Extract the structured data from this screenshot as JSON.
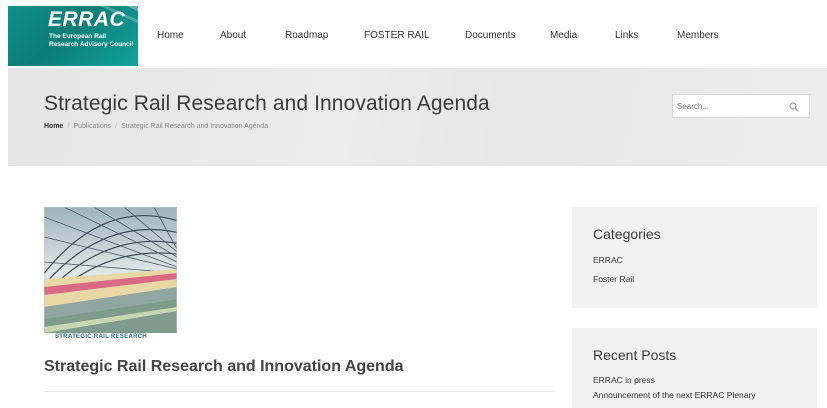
{
  "logo": {
    "brand": "ERRAC",
    "tagline": "The European Rail Research Advisory Council",
    "color": "#0f8f88"
  },
  "nav": {
    "items": [
      {
        "label": "Home"
      },
      {
        "label": "About"
      },
      {
        "label": "Roadmap"
      },
      {
        "label": "FOSTER RAIL"
      },
      {
        "label": "Documents"
      },
      {
        "label": "Media"
      },
      {
        "label": "Links"
      },
      {
        "label": "Members"
      }
    ]
  },
  "title_band": {
    "title": "Strategic Rail Research and Innovation Agenda",
    "breadcrumb": [
      "Home",
      "Publications",
      "Strategic Rail Research and Innovation Agenda"
    ],
    "breadcrumb_separator": "/"
  },
  "search": {
    "placeholder": "Search...",
    "icon": "search-icon"
  },
  "article": {
    "thumbnail_caption": "STRATEGIC RAIL RESEARCH",
    "title": "Strategic Rail Research and Innovation Agenda"
  },
  "sidebar": {
    "categories": {
      "title": "Categories",
      "items": [
        "ERRAC",
        "Foster Rail"
      ]
    },
    "recent_posts": {
      "title": "Recent Posts",
      "items": [
        "ERRAC in press",
        "Announcement of the next ERRAC Plenary"
      ]
    }
  }
}
